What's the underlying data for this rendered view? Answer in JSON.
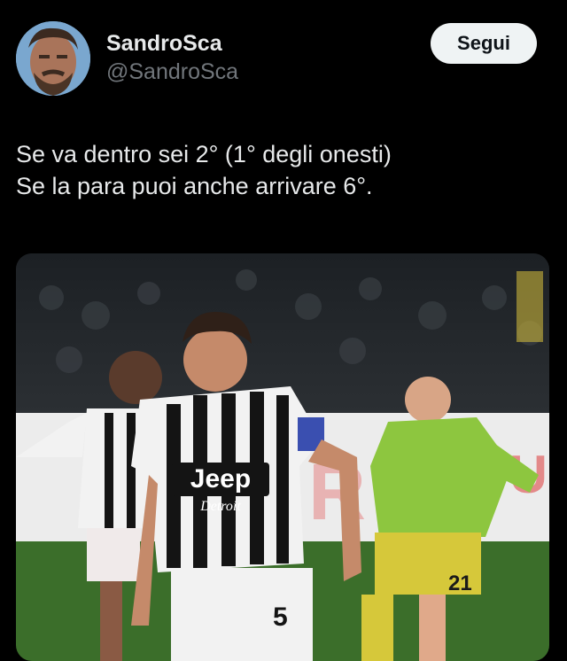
{
  "author": {
    "display_name": "SandroSca",
    "handle": "@SandroSca",
    "avatar_icon": "profile-avatar"
  },
  "actions": {
    "follow_label": "Segui"
  },
  "tweet": {
    "lines": [
      "Se va dentro sei 2° (1° degli onesti)",
      "Se la para puoi anche arrivare 6°."
    ]
  },
  "media": {
    "description_icon": "football-photo",
    "kit_sponsor": "Jeep",
    "kit_sub_sponsor": "Detroit",
    "player_number_main": "5",
    "player_number_right": "21",
    "colors": {
      "pitch": "#3b6e2a",
      "kit_black": "#141414",
      "kit_white": "#f2f2f2",
      "opponent_kit": "#8dc63f",
      "opponent_shorts": "#d6c83a"
    }
  }
}
